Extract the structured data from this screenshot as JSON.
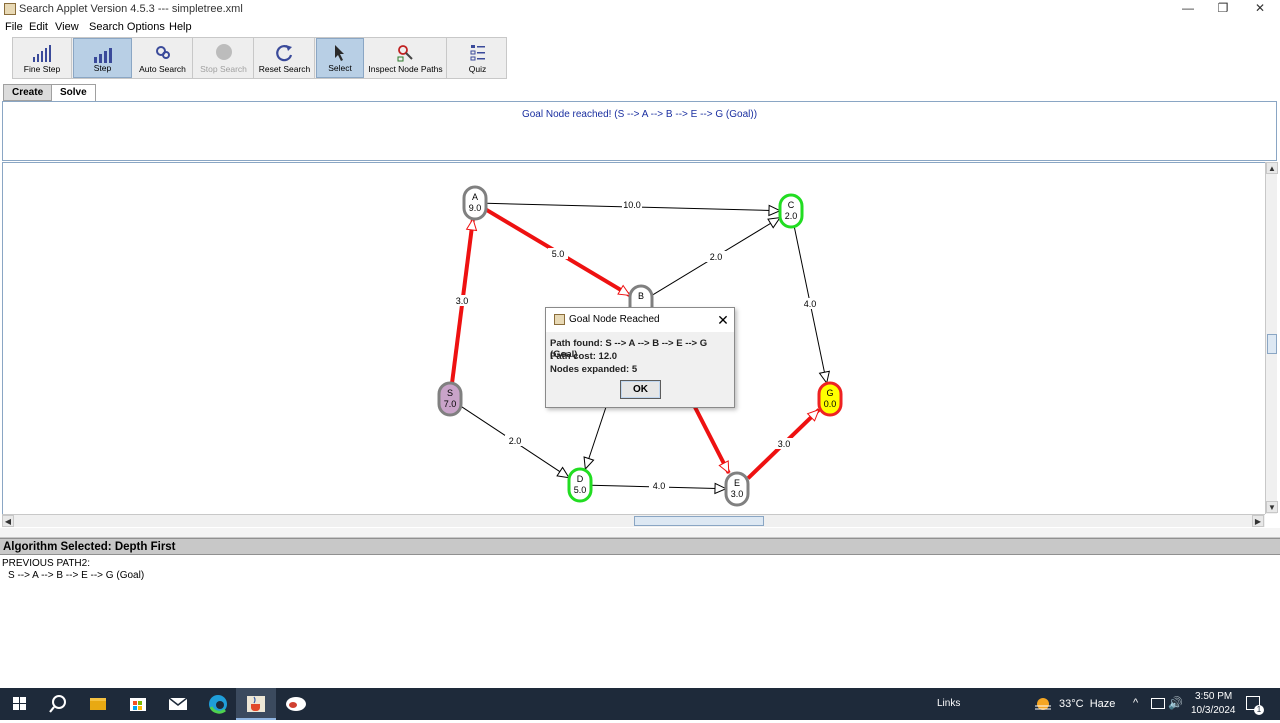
{
  "window": {
    "title": "Search Applet Version 4.5.3 --- simpletree.xml",
    "controls": [
      "—",
      "❐",
      "✕"
    ]
  },
  "menu": [
    "File",
    "Edit",
    "View",
    "Search Options",
    "Help"
  ],
  "toolbar": {
    "buttons": [
      {
        "label": "Fine Step",
        "icon": "fine-step-icon",
        "selected": false,
        "enabled": true
      },
      {
        "label": "Step",
        "icon": "step-icon",
        "selected": true,
        "enabled": true
      },
      {
        "label": "Auto Search",
        "icon": "auto-search-icon",
        "selected": false,
        "enabled": true
      },
      {
        "label": "Stop Search",
        "icon": "stop-search-icon",
        "selected": false,
        "enabled": false
      },
      {
        "label": "Reset Search",
        "icon": "reset-search-icon",
        "selected": false,
        "enabled": true
      },
      {
        "label": "Select",
        "icon": "select-cursor-icon",
        "selected": true,
        "enabled": true
      },
      {
        "label": "Inspect Node Paths",
        "icon": "inspect-paths-icon",
        "selected": false,
        "enabled": true
      },
      {
        "label": "Quiz",
        "icon": "quiz-icon",
        "selected": false,
        "enabled": true
      }
    ]
  },
  "tabs": [
    {
      "label": "Create",
      "active": false
    },
    {
      "label": "Solve",
      "active": true
    }
  ],
  "message": "Goal Node reached! (S --> A --> B --> E --> G (Goal))",
  "graph": {
    "nodes": [
      {
        "id": "A",
        "heuristic": "9.0",
        "fill": "#ffffff",
        "border": "#808080"
      },
      {
        "id": "B",
        "heuristic": "",
        "fill": "#ffffff",
        "border": "#808080"
      },
      {
        "id": "C",
        "heuristic": "2.0",
        "fill": "#ffffff",
        "border": "#22dd22"
      },
      {
        "id": "S",
        "heuristic": "7.0",
        "fill": "#c9a3c9",
        "border": "#808080"
      },
      {
        "id": "G",
        "heuristic": "0.0",
        "fill": "#ffff00",
        "border": "#ee2222"
      },
      {
        "id": "D",
        "heuristic": "5.0",
        "fill": "#ffffff",
        "border": "#22dd22"
      },
      {
        "id": "E",
        "heuristic": "3.0",
        "fill": "#ffffff",
        "border": "#808080"
      }
    ],
    "edges": [
      {
        "from": "S",
        "to": "A",
        "cost": "3.0",
        "on_path": true
      },
      {
        "from": "A",
        "to": "B",
        "cost": "5.0",
        "on_path": true
      },
      {
        "from": "A",
        "to": "C",
        "cost": "10.0",
        "on_path": false
      },
      {
        "from": "B",
        "to": "C",
        "cost": "2.0",
        "on_path": false
      },
      {
        "from": "C",
        "to": "G",
        "cost": "4.0",
        "on_path": false
      },
      {
        "from": "S",
        "to": "D",
        "cost": "2.0",
        "on_path": false
      },
      {
        "from": "D",
        "to": "E",
        "cost": "4.0",
        "on_path": false
      },
      {
        "from": "B",
        "to": "D",
        "cost": "",
        "on_path": false
      },
      {
        "from": "B",
        "to": "E",
        "cost": "",
        "on_path": true
      },
      {
        "from": "E",
        "to": "G",
        "cost": "3.0",
        "on_path": true
      }
    ],
    "path_color": "#ee1111",
    "edge_color": "#000000"
  },
  "dialog": {
    "title": "Goal Node Reached",
    "lines": [
      "Path found: S --> A --> B --> E --> G (Goal)",
      "Path cost: 12.0",
      "Nodes expanded: 5"
    ],
    "ok_label": "OK"
  },
  "algorithm": "Algorithm Selected: Depth First",
  "output": {
    "line1": "PREVIOUS PATH2:",
    "line2": "S --> A --> B --> E --> G (Goal)"
  },
  "taskbar": {
    "links_label": "Links",
    "weather": "33°C  Haze",
    "time": "3:50 PM",
    "date": "10/3/2024",
    "notification_count": "1"
  }
}
